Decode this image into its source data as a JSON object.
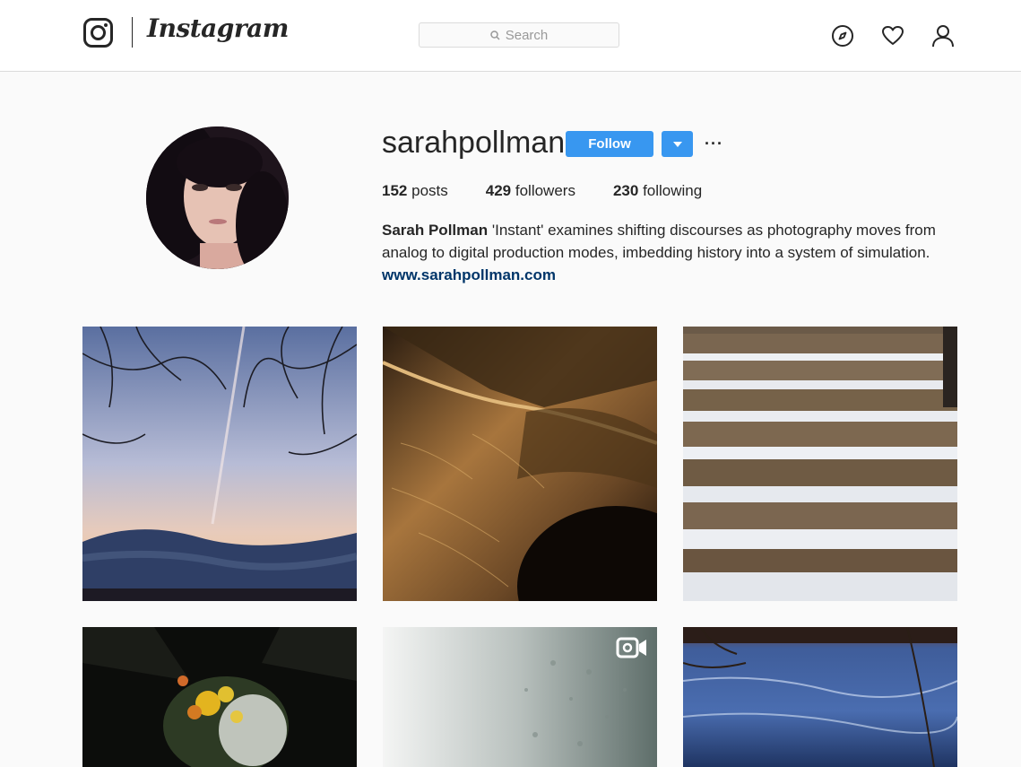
{
  "header": {
    "wordmark": "Instagram",
    "search_placeholder": "Search"
  },
  "profile": {
    "username": "sarahpollman",
    "follow_label": "Follow",
    "more_label": "···",
    "stats": {
      "posts_count": "152",
      "posts_label": "posts",
      "followers_count": "429",
      "followers_label": "followers",
      "following_count": "230",
      "following_label": "following"
    },
    "bio": {
      "full_name": "Sarah Pollman",
      "text": "'Instant' examines shifting discourses as photography moves from analog to digital production modes, imbedding history into a system of simulation.",
      "website": "www.sarahpollman.com"
    }
  },
  "colors": {
    "accent": "#3897f0",
    "link": "#003569",
    "border": "#dbdbdb",
    "background": "#fafafa"
  },
  "icons": [
    "instagram-logo-icon",
    "search-icon",
    "compass-icon",
    "heart-icon",
    "user-icon",
    "chevron-down-icon",
    "video-icon"
  ]
}
